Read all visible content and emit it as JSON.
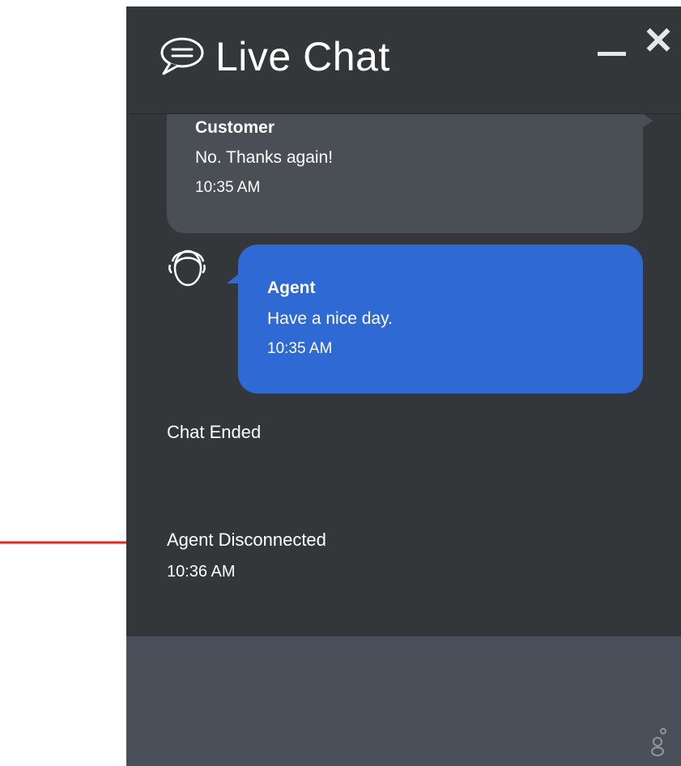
{
  "window": {
    "title": "Live Chat"
  },
  "icons": {
    "chat": "chat-bubble-icon",
    "minimize": "minimize-icon",
    "close": "close-icon",
    "agent_avatar": "agent-headset-icon",
    "brand": "genesys-logo-icon",
    "annotation": "red-arrow-icon"
  },
  "controls": {
    "minimize_label": "—",
    "close_label": "✕"
  },
  "messages": [
    {
      "sender": "Customer",
      "text": "No. Thanks again!",
      "time": "10:35 AM"
    },
    {
      "sender": "Agent",
      "text": "Have a nice day.",
      "time": "10:35 AM"
    }
  ],
  "system_messages": [
    {
      "text": "Chat Ended"
    },
    {
      "text": "Agent Disconnected",
      "time": "10:36 AM"
    }
  ],
  "colors": {
    "panel_bg": "#33373a",
    "customer_bubble": "#4a4f55",
    "agent_bubble": "#2f69d3",
    "input_bg": "#4a5059",
    "annotation_arrow": "#e8231c"
  }
}
